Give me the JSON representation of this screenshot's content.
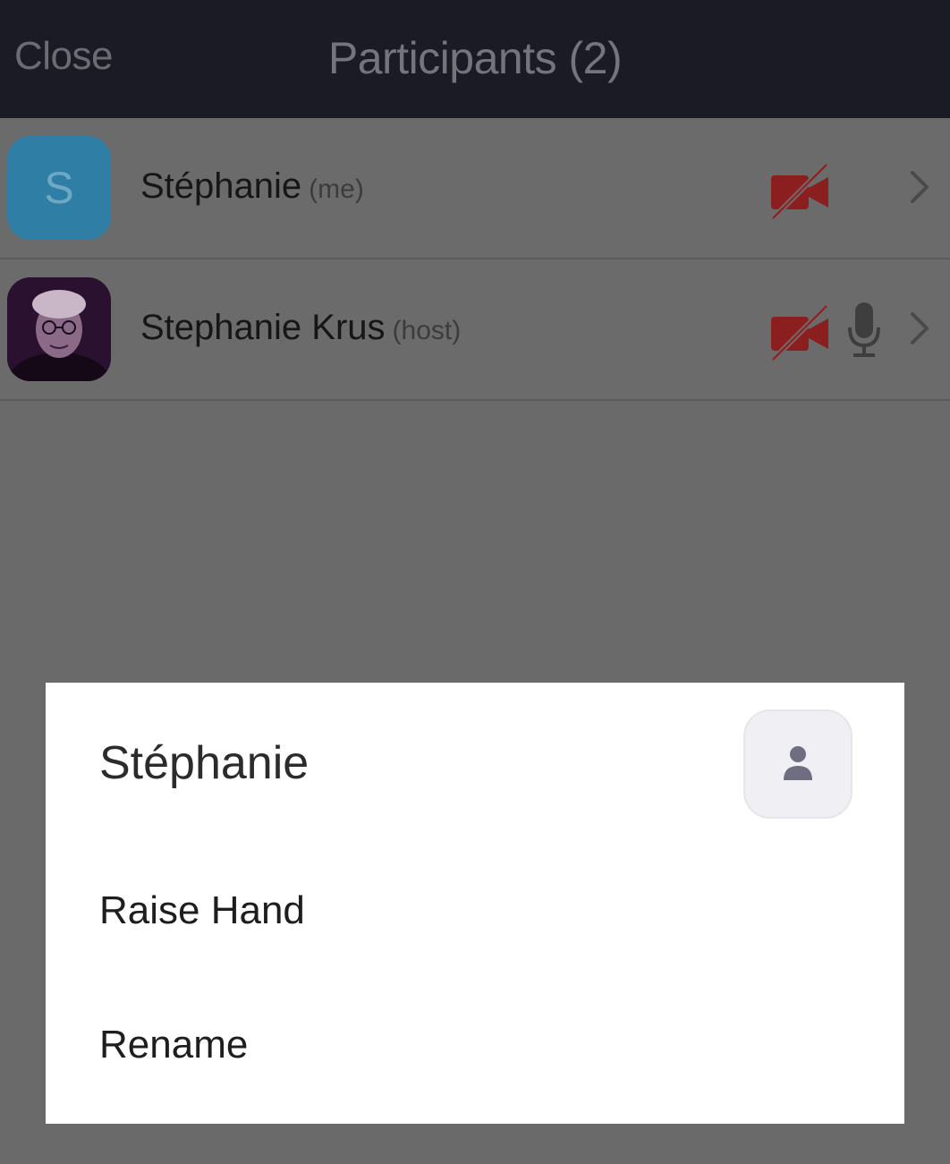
{
  "header": {
    "close_label": "Close",
    "title": "Participants (2)"
  },
  "participants": [
    {
      "avatar_letter": "S",
      "avatar_color": "#2e7ea6",
      "name": "Stéphanie",
      "tag": "(me)",
      "video_icon": "video-off-icon",
      "mic_icon": null
    },
    {
      "avatar_photo": "avatar-photo",
      "name": "Stephanie Krus",
      "tag": "(host)",
      "video_icon": "video-off-icon",
      "mic_icon": "microphone-icon"
    }
  ],
  "sheet": {
    "title": "Stéphanie",
    "items": [
      {
        "label": "Raise Hand"
      },
      {
        "label": "Rename"
      }
    ]
  },
  "colors": {
    "header_bg": "#1b1b25",
    "overlay": "#6a6a6a",
    "video_off": "#8b1f1f"
  }
}
